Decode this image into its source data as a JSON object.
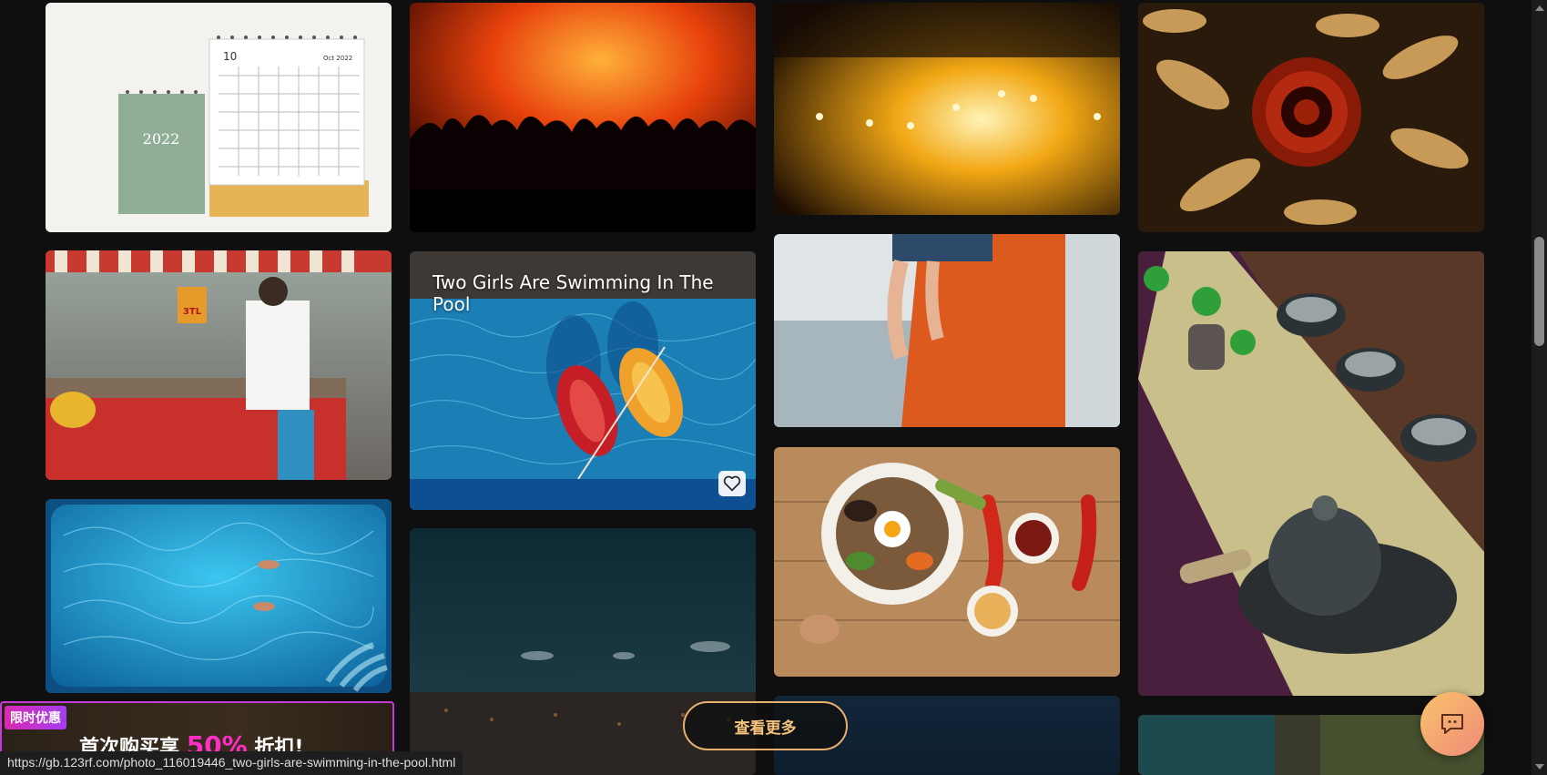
{
  "gallery": {
    "hovered_title": "Two Girls Are Swimming In The Pool",
    "tiles": [
      {
        "name": "desk-calendar-2022",
        "calendar_year": "2022",
        "calendar_day": "10",
        "calendar_month": "Oct 2022"
      },
      {
        "name": "concert-crowd-red"
      },
      {
        "name": "stage-spotlights"
      },
      {
        "name": "dried-rose"
      },
      {
        "name": "street-food-cart",
        "cart_sign": "3TL"
      },
      {
        "name": "two-girls-pool"
      },
      {
        "name": "parent-carrying-child"
      },
      {
        "name": "tea-set"
      },
      {
        "name": "pool-aerial"
      },
      {
        "name": "night-city-sky"
      },
      {
        "name": "bibimbap"
      },
      {
        "name": "partial-bottom-blue"
      },
      {
        "name": "partial-bottom-right"
      }
    ]
  },
  "more_button": {
    "label": "查看更多"
  },
  "promo": {
    "tag": "限时优惠",
    "headline_prefix": "首次购买享",
    "headline_percent": "50%",
    "headline_suffix": "折扣!"
  },
  "status_url": "https://gb.123rf.com/photo_116019446_two-girls-are-swimming-in-the-pool.html",
  "icons": {
    "favorite": "heart-icon",
    "chat": "chat-bubble-icon"
  }
}
